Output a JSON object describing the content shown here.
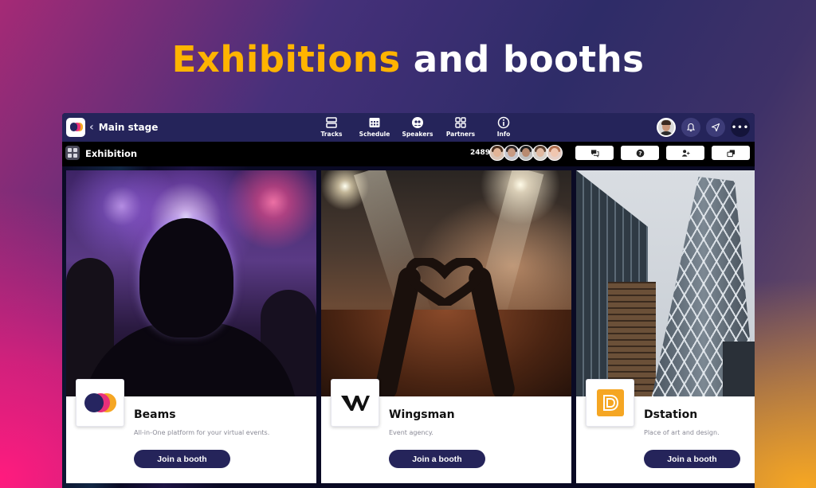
{
  "headline": {
    "accent": "Exhibitions",
    "rest": " and booths"
  },
  "colors": {
    "accent": "#ffb400",
    "brand_dark": "#25245a",
    "beams_pink": "#e8307a",
    "beams_orange": "#f5a623"
  },
  "topbar": {
    "back_label": "Main stage",
    "nav": [
      {
        "label": "Tracks",
        "icon": "tracks-icon"
      },
      {
        "label": "Schedule",
        "icon": "calendar-icon"
      },
      {
        "label": "Speakers",
        "icon": "speakers-icon"
      },
      {
        "label": "Partners",
        "icon": "grid-icon"
      },
      {
        "label": "Info",
        "icon": "info-icon"
      }
    ],
    "actions": [
      {
        "icon": "bell-icon"
      },
      {
        "icon": "send-icon"
      },
      {
        "icon": "more-icon",
        "label": "•••"
      }
    ]
  },
  "subbar": {
    "title": "Exhibition",
    "attendee_count": "2489",
    "actions": [
      {
        "icon": "chat-icon"
      },
      {
        "icon": "help-icon"
      },
      {
        "icon": "people-icon"
      },
      {
        "icon": "windows-icon"
      }
    ]
  },
  "booths": [
    {
      "name": "Beams",
      "description": "All-in-One platform for your virtual events.",
      "button": "Join a booth"
    },
    {
      "name": "Wingsman",
      "description": "Event agency.",
      "button": "Join a booth"
    },
    {
      "name": "Dstation",
      "description": "Place of art and design.",
      "button": "Join a booth"
    }
  ]
}
